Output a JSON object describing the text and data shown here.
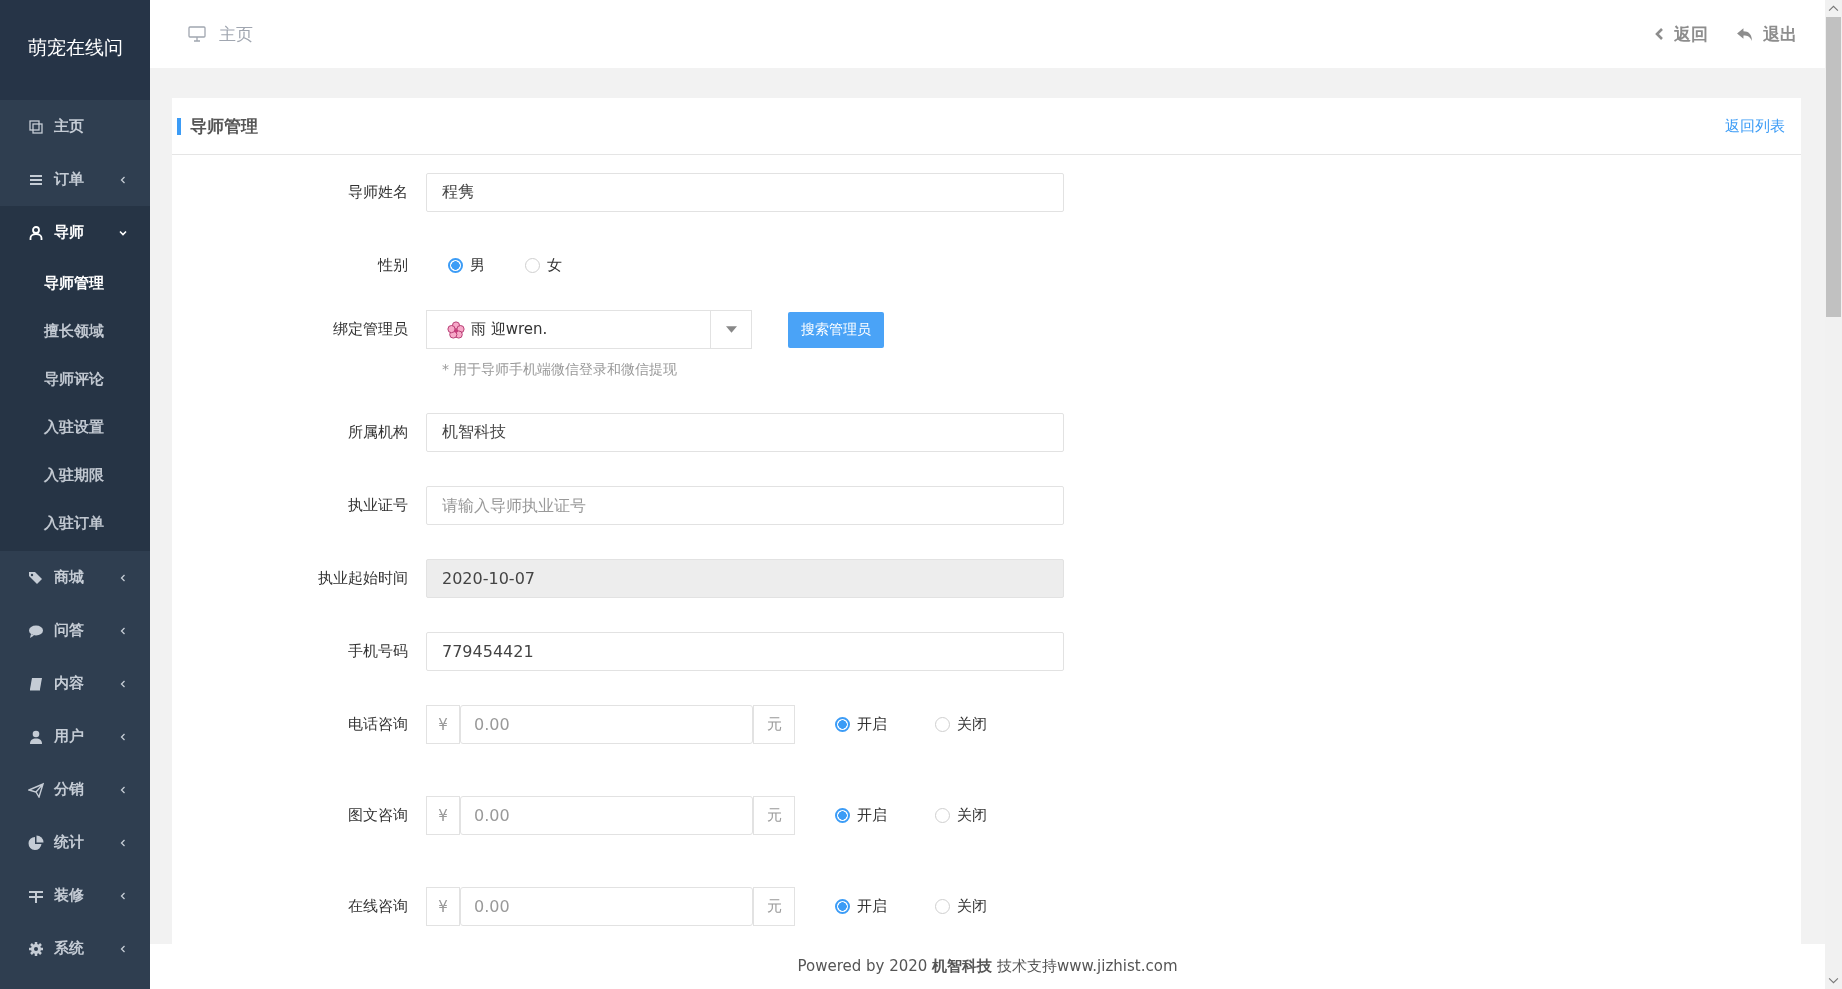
{
  "sidebar": {
    "logo": "萌宠在线问",
    "items": [
      {
        "label": "主页",
        "selected": false
      },
      {
        "label": "订单",
        "expanded": false,
        "selected": false
      },
      {
        "label": "导师",
        "expanded": true,
        "selected": true,
        "children": [
          {
            "label": "导师管理",
            "selected": true
          },
          {
            "label": "擅长领域",
            "selected": false
          },
          {
            "label": "导师评论",
            "selected": false
          },
          {
            "label": "入驻设置",
            "selected": false
          },
          {
            "label": "入驻期限",
            "selected": false
          },
          {
            "label": "入驻订单",
            "selected": false
          }
        ]
      },
      {
        "label": "商城",
        "expanded": false,
        "selected": false
      },
      {
        "label": "问答",
        "expanded": false,
        "selected": false
      },
      {
        "label": "内容",
        "expanded": false,
        "selected": false
      },
      {
        "label": "用户",
        "expanded": false,
        "selected": false
      },
      {
        "label": "分销",
        "expanded": false,
        "selected": false
      },
      {
        "label": "统计",
        "expanded": false,
        "selected": false
      },
      {
        "label": "装修",
        "expanded": false,
        "selected": false
      },
      {
        "label": "系统",
        "expanded": false,
        "selected": false
      }
    ]
  },
  "topbar": {
    "breadcrumb": "主页",
    "actions": [
      "返回",
      "退出"
    ]
  },
  "card": {
    "title": "导师管理",
    "link": "返回列表",
    "fields": [
      {
        "kind": "text",
        "label": "导师姓名",
        "value": "程隽"
      },
      {
        "kind": "radio",
        "label": "性别",
        "options": [
          {
            "label": "男",
            "selected": true
          },
          {
            "label": "女",
            "selected": false
          }
        ]
      },
      {
        "kind": "select",
        "label": "绑定管理员",
        "value": "雨 迎wren.",
        "button": "搜索管理员",
        "hint": "* 用于导师手机端微信登录和微信提现"
      },
      {
        "kind": "text",
        "label": "所属机构",
        "value": "机智科技"
      },
      {
        "kind": "text",
        "label": "执业证号",
        "placeholder": "请输入导师执业证号"
      },
      {
        "kind": "text",
        "label": "执业起始时间",
        "value": "2020-10-07",
        "disabled": true
      },
      {
        "kind": "text",
        "label": "手机号码",
        "value": "779454421"
      },
      {
        "kind": "price",
        "label": "电话咨询",
        "prefix": "¥",
        "placeholder": "0.00",
        "suffix": "元",
        "options": [
          {
            "label": "开启",
            "selected": true
          },
          {
            "label": "关闭",
            "selected": false
          }
        ]
      },
      {
        "kind": "price",
        "label": "图文咨询",
        "prefix": "¥",
        "placeholder": "0.00",
        "suffix": "元",
        "options": [
          {
            "label": "开启",
            "selected": true
          },
          {
            "label": "关闭",
            "selected": false
          }
        ]
      },
      {
        "kind": "price",
        "label": "在线咨询",
        "prefix": "¥",
        "placeholder": "0.00",
        "suffix": "元",
        "options": [
          {
            "label": "开启",
            "selected": true
          },
          {
            "label": "关闭",
            "selected": false
          }
        ]
      }
    ]
  },
  "footer": "Powered by 2020 **机智科技** 技术支持www.jizhist.com"
}
